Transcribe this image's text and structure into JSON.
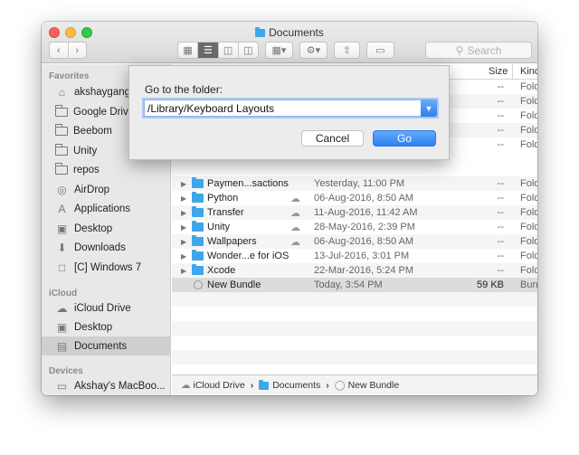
{
  "window": {
    "title": "Documents"
  },
  "toolbar": {
    "search_placeholder": "Search"
  },
  "sidebar": {
    "favorites_header": "Favorites",
    "favorites": [
      {
        "label": "akshaygangw",
        "icon": "home-icon"
      },
      {
        "label": "Google Drive",
        "icon": "folder-icon"
      },
      {
        "label": "Beebom",
        "icon": "folder-icon"
      },
      {
        "label": "Unity",
        "icon": "folder-icon"
      },
      {
        "label": "repos",
        "icon": "folder-icon"
      },
      {
        "label": "AirDrop",
        "icon": "airdrop-icon"
      },
      {
        "label": "Applications",
        "icon": "applications-icon"
      },
      {
        "label": "Desktop",
        "icon": "desktop-icon"
      },
      {
        "label": "Downloads",
        "icon": "downloads-icon"
      },
      {
        "label": "[C] Windows 7",
        "icon": "document-icon"
      }
    ],
    "icloud_header": "iCloud",
    "icloud": [
      {
        "label": "iCloud Drive",
        "icon": "cloud-icon"
      },
      {
        "label": "Desktop",
        "icon": "desktop-icon"
      },
      {
        "label": "Documents",
        "icon": "documents-icon"
      }
    ],
    "devices_header": "Devices",
    "devices": [
      {
        "label": "Akshay's MacBoo...",
        "icon": "laptop-icon"
      }
    ]
  },
  "columns": {
    "size": "Size",
    "kind": "Kind"
  },
  "files": [
    {
      "name": "Paymen...sactions",
      "date": "Yesterday, 11:00 PM",
      "size": "--",
      "kind": "Fold"
    },
    {
      "name": "Python",
      "date": "06-Aug-2016, 8:50 AM",
      "size": "--",
      "kind": "Fold"
    },
    {
      "name": "Transfer",
      "date": "11-Aug-2016, 11:42 AM",
      "size": "--",
      "kind": "Fold"
    },
    {
      "name": "Unity",
      "date": "28-May-2016, 2:39 PM",
      "size": "--",
      "kind": "Fold"
    },
    {
      "name": "Wallpapers",
      "date": "06-Aug-2016, 8:50 AM",
      "size": "--",
      "kind": "Fold"
    },
    {
      "name": "Wonder...e for iOS",
      "date": "13-Jul-2016, 3:01 PM",
      "size": "--",
      "kind": "Fold"
    },
    {
      "name": "Xcode",
      "date": "22-Mar-2016, 5:24 PM",
      "size": "--",
      "kind": "Fold"
    },
    {
      "name": "New Bundle",
      "date": "Today, 3:54 PM",
      "size": "59 KB",
      "kind": "Bun"
    }
  ],
  "hidden_rows_dash": [
    "--",
    "--",
    "--",
    "--",
    "--"
  ],
  "hidden_rows_kind": [
    "Fold",
    "Fold",
    "Fold",
    "Fold",
    "Fold"
  ],
  "pathbar": {
    "root": "iCloud Drive",
    "folder": "Documents",
    "item": "New Bundle"
  },
  "dialog": {
    "label": "Go to the folder:",
    "value": "/Library/Keyboard Layouts",
    "cancel": "Cancel",
    "go": "Go"
  }
}
